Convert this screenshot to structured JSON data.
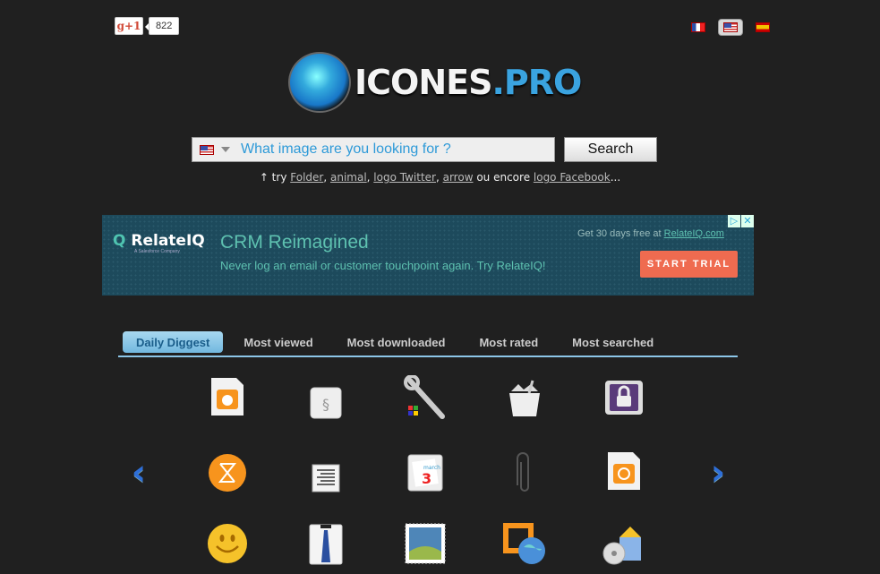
{
  "social": {
    "gplus_label": "g+1",
    "gplus_count": "822"
  },
  "languages": [
    {
      "name": "French",
      "icon": "flag-fr",
      "selected": false
    },
    {
      "name": "English",
      "icon": "flag-us",
      "selected": true
    },
    {
      "name": "Spanish",
      "icon": "flag-es",
      "selected": false
    }
  ],
  "logo": {
    "main": "ICONES",
    "dot": ".",
    "tld": "PRO"
  },
  "search": {
    "placeholder": "What image are you looking for ?",
    "value": "",
    "button_label": "Search",
    "language_icon": "flag-us"
  },
  "hint": {
    "prefix": "↑ try ",
    "links": [
      "Folder",
      "animal",
      "logo Twitter",
      "arrow"
    ],
    "middle": " ou encore ",
    "last_link": "logo Facebook",
    "suffix": "..."
  },
  "ad": {
    "brand": "RelateIQ",
    "brand_sub": "A Salesforce Company",
    "headline": "CRM Reimagined",
    "body": "Never log an email or customer touchpoint again. Try RelateIQ!",
    "offer_text": "Get 30 days free at ",
    "offer_link": "RelateIQ.com",
    "cta": "START TRIAL",
    "colors": {
      "background": "#1d4a5c",
      "accent": "#5ec1b0",
      "cta": "#ef6b50"
    }
  },
  "tabs": [
    {
      "label": "Daily Diggest",
      "active": true
    },
    {
      "label": "Most viewed",
      "active": false
    },
    {
      "label": "Most downloaded",
      "active": false
    },
    {
      "label": "Most rated",
      "active": false
    },
    {
      "label": "Most searched",
      "active": false
    }
  ],
  "carousel": {
    "prev_icon": "chevron-left-icon",
    "next_icon": "chevron-right-icon",
    "icons": [
      [
        "apple-file-icon",
        "section-key-icon",
        "wine-wrench-icon",
        "trash-bin-icon",
        "lock-icon"
      ],
      [
        "zune-icon",
        "align-right-text-icon",
        "calendar-march-3-icon",
        "paperclip-icon",
        "audio-file-icon"
      ],
      [
        "smiley-icon",
        "shirt-tie-icon",
        "stamp-image-icon",
        "web-share-icon",
        "software-install-icon"
      ]
    ]
  }
}
